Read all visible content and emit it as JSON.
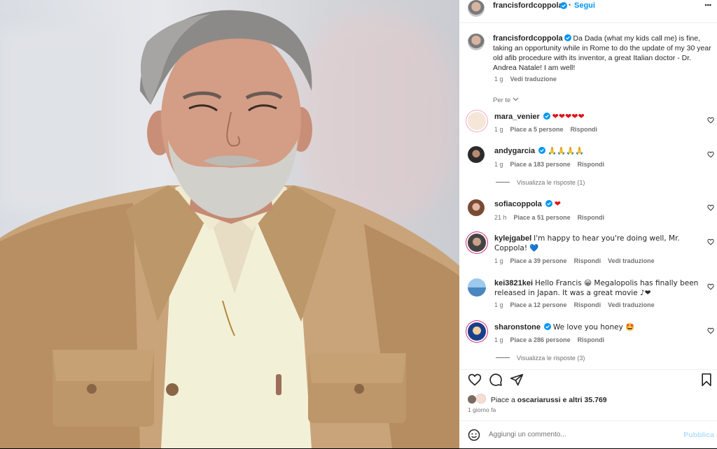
{
  "post": {
    "author": "francisfordcoppola",
    "follow_label": "Segui",
    "more_label": "•••",
    "caption": "Da Dada (what my kids call me) is fine, taking an opportunity while in Rome to do the update of my 30 year old afib procedure with its inventor, a great Italian doctor - Dr. Andrea Natale! I am well!",
    "caption_time": "1 g",
    "caption_translate": "Vedi traduzione",
    "filter_label": "Per te",
    "photo_alt": "Portrait of Francis Ford Coppola in a tan jacket"
  },
  "comments": [
    {
      "user": "mara_venier",
      "verified": true,
      "text": "❤❤❤❤❤",
      "time": "1 g",
      "likes": "Piace a 5 persone",
      "reply": "Rispondi",
      "translate": "",
      "replies": ""
    },
    {
      "user": "andygarcia",
      "verified": true,
      "text": "🙏🙏🙏🙏",
      "time": "1 g",
      "likes": "Piace a 183 persone",
      "reply": "Rispondi",
      "translate": "",
      "replies": "Visualizza le risposte (1)"
    },
    {
      "user": "sofiacoppola",
      "verified": true,
      "text": "❤",
      "time": "21 h",
      "likes": "Piace a 51 persone",
      "reply": "Rispondi",
      "translate": "",
      "replies": ""
    },
    {
      "user": "kylejgabel",
      "verified": false,
      "text": "I'm happy to hear you're doing well, Mr. Coppola! 💙",
      "time": "1 g",
      "likes": "Piace a 39 persone",
      "reply": "Rispondi",
      "translate": "Vedi traduzione",
      "replies": ""
    },
    {
      "user": "kei3821kei",
      "verified": false,
      "text": "Hello Francis 😀 Megalopolis has finally been released in Japan. It was a great movie ♪❤",
      "time": "1 g",
      "likes": "Piace a 12 persone",
      "reply": "Rispondi",
      "translate": "Vedi traduzione",
      "replies": ""
    },
    {
      "user": "sharonstone",
      "verified": true,
      "text": "We love you honey 🤩",
      "time": "1 g",
      "likes": "Piace a 286 persone",
      "reply": "Rispondi",
      "translate": "",
      "replies": "Visualizza le risposte (3)"
    }
  ],
  "footer": {
    "likes_prefix": "Piace a ",
    "likes_user": "oscariarussi",
    "likes_suffix": " e altri 35.769",
    "time": "1 giorno fa",
    "comment_placeholder": "Aggiungi un commento...",
    "publish_label": "Pubblica"
  },
  "colors": {
    "accent": "#0095f6",
    "verified": "#0095f6",
    "heart": "#e0141c",
    "jacket": "#c9a47a"
  }
}
